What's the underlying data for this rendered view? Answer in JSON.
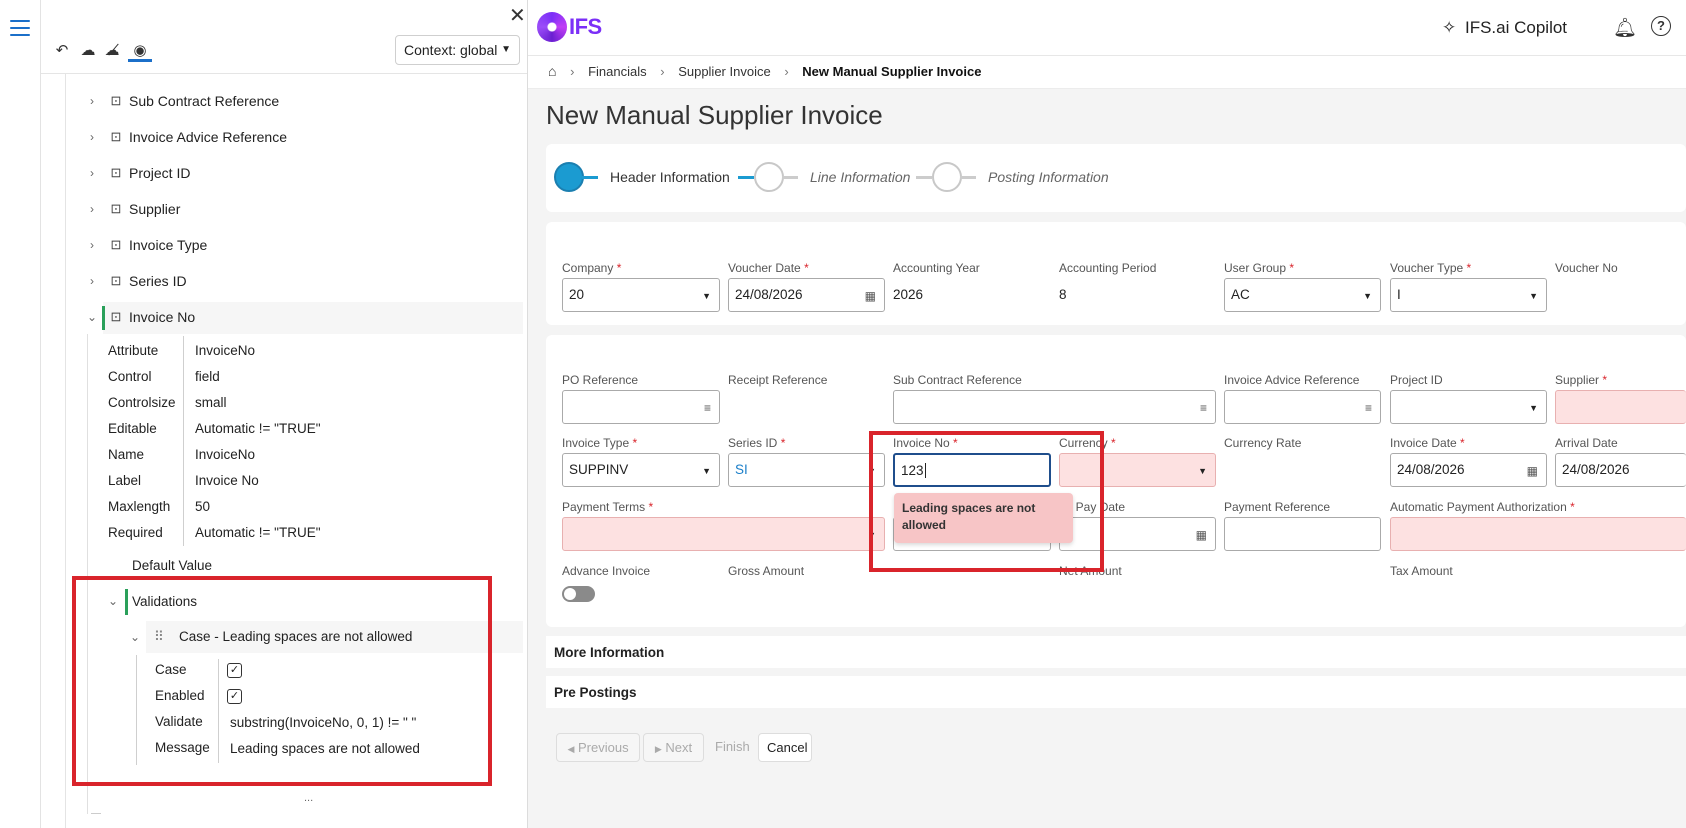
{
  "designer": {
    "context_label": "Context: global",
    "tree_nodes": [
      {
        "label": "Sub Contract Reference"
      },
      {
        "label": "Invoice Advice Reference"
      },
      {
        "label": "Project ID"
      },
      {
        "label": "Supplier"
      },
      {
        "label": "Invoice Type"
      },
      {
        "label": "Series ID"
      },
      {
        "label": "Invoice No"
      }
    ],
    "properties": [
      {
        "key": "Attribute",
        "value": "InvoiceNo"
      },
      {
        "key": "Control",
        "value": "field"
      },
      {
        "key": "Controlsize",
        "value": "small"
      },
      {
        "key": "Editable",
        "value": "Automatic != \"TRUE\""
      },
      {
        "key": "Name",
        "value": "InvoiceNo"
      },
      {
        "key": "Label",
        "value": "Invoice No"
      },
      {
        "key": "Maxlength",
        "value": "50"
      },
      {
        "key": "Required",
        "value": "Automatic != \"TRUE\""
      }
    ],
    "default_value_label": "Default Value",
    "validations_label": "Validations",
    "case_title": "Case - Leading spaces are not allowed",
    "case_props": [
      {
        "key": "Case",
        "value": ""
      },
      {
        "key": "Enabled",
        "value": ""
      },
      {
        "key": "Validate",
        "value": "substring(InvoiceNo, 0, 1) != \" \""
      },
      {
        "key": "Message",
        "value": "Leading spaces are not allowed"
      }
    ],
    "ellipsis": "..."
  },
  "header": {
    "logo": "IFS",
    "copilot": "IFS.ai Copilot"
  },
  "breadcrumb": {
    "items": [
      "Financials",
      "Supplier Invoice"
    ],
    "current": "New Manual Supplier Invoice"
  },
  "page": {
    "title": "New Manual Supplier Invoice",
    "steps": [
      "Header Information",
      "Line Information",
      "Posting Information"
    ]
  },
  "form1": {
    "company": {
      "label": "Company",
      "value": "20"
    },
    "voucher_date": {
      "label": "Voucher Date",
      "value": "24/08/2026"
    },
    "acc_year": {
      "label": "Accounting Year",
      "value": "2026"
    },
    "acc_period": {
      "label": "Accounting Period",
      "value": "8"
    },
    "user_group": {
      "label": "User Group",
      "value": "AC"
    },
    "voucher_type": {
      "label": "Voucher Type",
      "value": "I"
    },
    "voucher_no": {
      "label": "Voucher No"
    }
  },
  "form2": {
    "po_ref": {
      "label": "PO Reference"
    },
    "receipt_ref": {
      "label": "Receipt Reference"
    },
    "sub_contract_ref": {
      "label": "Sub Contract Reference"
    },
    "invoice_advice_ref": {
      "label": "Invoice Advice Reference"
    },
    "project_id": {
      "label": "Project ID"
    },
    "supplier": {
      "label": "Supplier"
    },
    "invoice_type": {
      "label": "Invoice Type",
      "value": "SUPPINV"
    },
    "series_id": {
      "label": "Series ID",
      "value": "SI"
    },
    "invoice_no": {
      "label": "Invoice No",
      "value": "123"
    },
    "currency": {
      "label": "Currency"
    },
    "currency_rate": {
      "label": "Currency Rate"
    },
    "invoice_date": {
      "label": "Invoice Date",
      "value": "24/08/2026"
    },
    "arrival_date": {
      "label": "Arrival Date",
      "value": "24/08/2026"
    },
    "payment_terms": {
      "label": "Payment Terms"
    },
    "plan_pay_date": {
      "label": "an Pay Date"
    },
    "payment_ref": {
      "label": "Payment Reference"
    },
    "auto_pay_auth": {
      "label": "Automatic Payment Authorization"
    },
    "advance_invoice": {
      "label": "Advance Invoice"
    },
    "gross_amount": {
      "label": "Gross Amount"
    },
    "net_amount": {
      "label": "Net Amount"
    },
    "tax_amount": {
      "label": "Tax Amount"
    },
    "error_message": "Leading spaces are not allowed"
  },
  "sections": {
    "more_info": "More Information",
    "pre_postings": "Pre Postings"
  },
  "buttons": {
    "previous": "Previous",
    "next": "Next",
    "finish": "Finish",
    "cancel": "Cancel"
  },
  "colors": {
    "accent": "#1b9bd1",
    "brand": "#7b2ff7",
    "error_bg": "#fde1e1",
    "highlight": "#d9242b"
  }
}
